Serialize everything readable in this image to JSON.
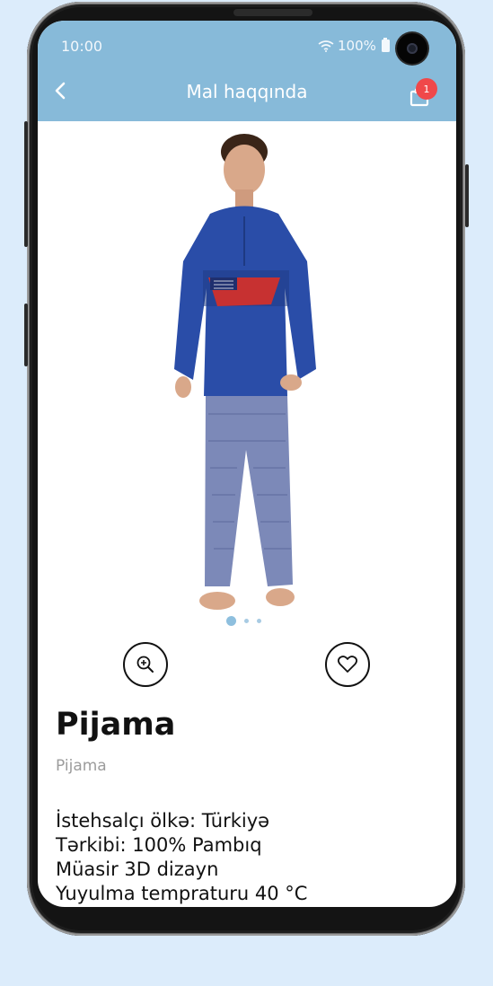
{
  "status_bar": {
    "time": "10:00",
    "battery": "100%"
  },
  "header": {
    "title": "Mal haqqında",
    "cart_count": "1"
  },
  "gallery": {
    "image_count": 3,
    "active_index": 0
  },
  "product": {
    "name": "Pijama",
    "category": "Pijama",
    "description": [
      "İstehsalçı ölkə: Türkiyə",
      "Tərkibi: 100%  Pambıq",
      "Müasir 3D dizayn",
      "Yuyulma tempraturu 40 °C"
    ]
  },
  "colors": {
    "header": "#87bad9",
    "badge": "#f0484a",
    "background": "#dcecfb"
  },
  "icons": [
    "back-icon",
    "shopping-bag-icon",
    "zoom-in-icon",
    "heart-icon",
    "wifi-icon",
    "battery-icon"
  ]
}
